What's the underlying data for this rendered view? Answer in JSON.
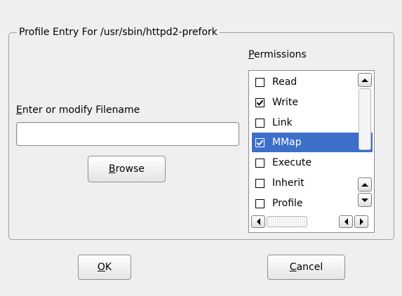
{
  "group": {
    "title": "Profile Entry For /usr/sbin/httpd2-prefork"
  },
  "filename": {
    "label_mnemonic": "E",
    "label_rest": "nter or modify Filename",
    "value": ""
  },
  "browse_button": {
    "mnemonic": "B",
    "rest": "rowse"
  },
  "permissions": {
    "label_mnemonic": "P",
    "label_rest": "ermissions",
    "items": [
      {
        "label": "Read",
        "checked": false,
        "selected": false
      },
      {
        "label": "Write",
        "checked": true,
        "selected": false
      },
      {
        "label": "Link",
        "checked": false,
        "selected": false
      },
      {
        "label": "MMap",
        "checked": true,
        "selected": true
      },
      {
        "label": "Execute",
        "checked": false,
        "selected": false
      },
      {
        "label": "Inherit",
        "checked": false,
        "selected": false
      },
      {
        "label": "Profile",
        "checked": false,
        "selected": false
      }
    ]
  },
  "ok_button": {
    "mnemonic": "O",
    "rest": "K"
  },
  "cancel_button": {
    "mnemonic": "C",
    "rest": "ancel"
  },
  "colors": {
    "selection": "#3d6fc9",
    "window_bg": "#efefef"
  }
}
